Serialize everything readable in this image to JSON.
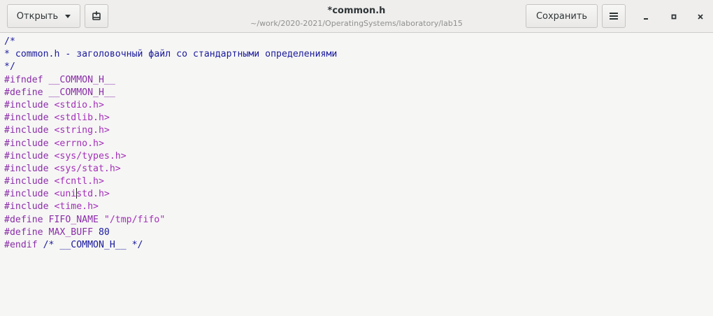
{
  "header": {
    "open_label": "Открыть",
    "save_label": "Сохранить",
    "title": "*common.h",
    "subtitle": "~/work/2020-2021/OperatingSystems/laboratory/lab15"
  },
  "icons": {
    "open_menu": "chevron-down-icon",
    "new_document": "new-document-icon",
    "hamburger": "hamburger-menu-icon",
    "minimize": "minimize-icon",
    "maximize": "maximize-icon",
    "close": "close-icon"
  },
  "editor": {
    "cursor_line": 12,
    "lines": [
      "/*",
      "* common.h - заголовочный файл со стандартными определениями",
      "*/",
      "#ifndef __COMMON_H__",
      "#define __COMMON_H__",
      "#include <stdio.h>",
      "#include <stdlib.h>",
      "#include <string.h>",
      "#include <errno.h>",
      "#include <sys/types.h>",
      "#include <sys/stat.h>",
      "#include <fcntl.h>",
      "#include <unistd.h>",
      "#include <time.h>",
      "#define FIFO_NAME \"/tmp/fifo\"",
      "#define MAX_BUFF 80",
      "#endif /* __COMMON_H__ */"
    ]
  },
  "colors": {
    "comment": "#1a1a9c",
    "preprocessor": "#8a2da8",
    "string": "#a42fb8",
    "number": "#1a1a9c"
  }
}
